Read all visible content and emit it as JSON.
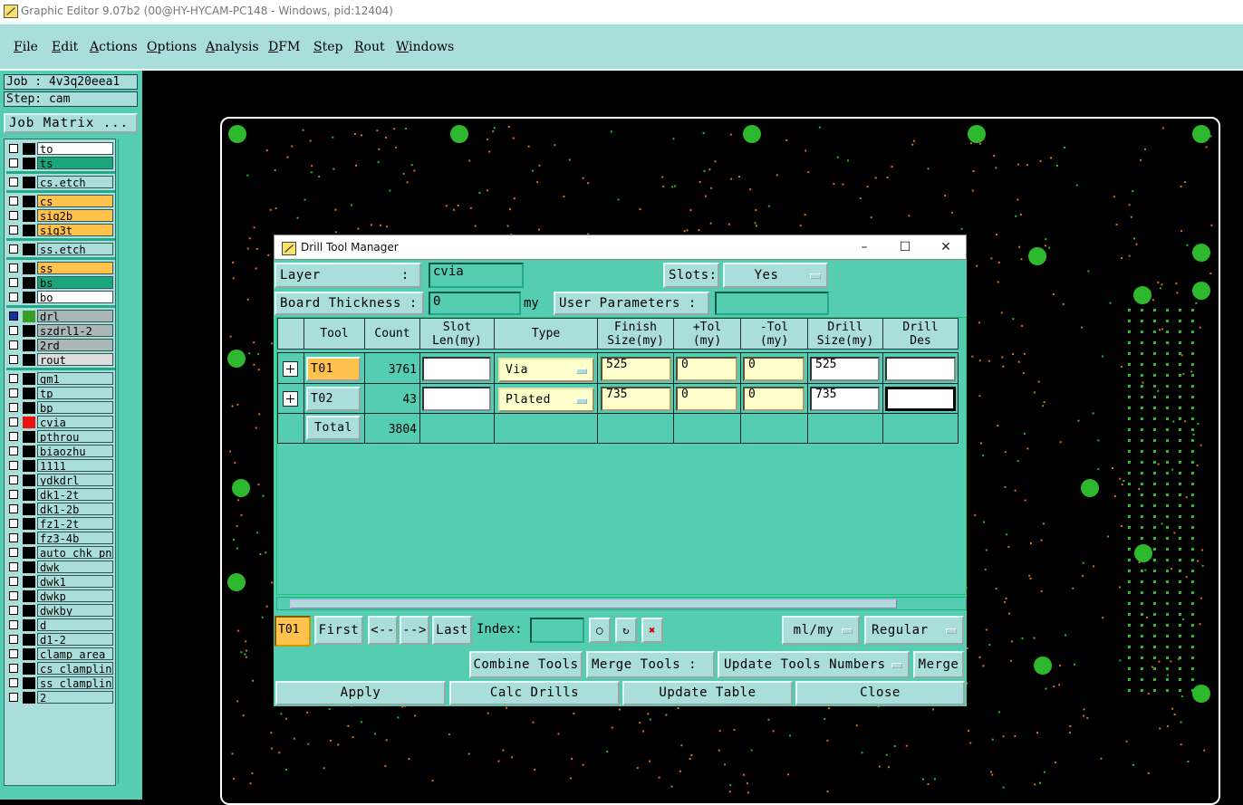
{
  "window": {
    "title": "Graphic Editor 9.07b2 (00@HY-HYCAM-PC148 - Windows, pid:12404)"
  },
  "menu": [
    "File",
    "Edit",
    "Actions",
    "Options",
    "Analysis",
    "DFM",
    "Step",
    "Rout",
    "Windows"
  ],
  "left": {
    "job": "Job : 4v3q20eea1",
    "step": "Step: cam",
    "job_matrix": "Job Matrix ..."
  },
  "layers": [
    {
      "name": "to",
      "bg": "#ffffff",
      "color": "#000000"
    },
    {
      "name": "ts",
      "bg": "#1aa57a",
      "color": "#000000"
    },
    {
      "name": "cs.etch",
      "bg": "#a9dedb",
      "color": "#000000"
    },
    {
      "name": "cs",
      "bg": "#ffc34d",
      "color": "#000000"
    },
    {
      "name": "sig2b",
      "bg": "#ffc34d",
      "color": "#000000"
    },
    {
      "name": "sig3t",
      "bg": "#ffc34d",
      "color": "#000000"
    },
    {
      "name": "ss.etch",
      "bg": "#a9dedb",
      "color": "#000000"
    },
    {
      "name": "ss",
      "bg": "#ffc34d",
      "color": "#000000"
    },
    {
      "name": "bs",
      "bg": "#1aa57a",
      "color": "#000000"
    },
    {
      "name": "bo",
      "bg": "#ffffff",
      "color": "#000000"
    },
    {
      "name": "drl",
      "bg": "#a9b7b6",
      "color": "#3a9e2b",
      "active": true
    },
    {
      "name": "szdrl1-2",
      "bg": "#a9b7b6",
      "color": "#000000"
    },
    {
      "name": "2rd",
      "bg": "#a9b7b6",
      "color": "#000000"
    },
    {
      "name": "rout",
      "bg": "#dddddd",
      "color": "#000000"
    },
    {
      "name": "gm1",
      "bg": "#a9dedb",
      "color": "#000000"
    },
    {
      "name": "tp",
      "bg": "#a9dedb",
      "color": "#000000"
    },
    {
      "name": "bp",
      "bg": "#a9dedb",
      "color": "#000000"
    },
    {
      "name": "cvia",
      "bg": "#a9dedb",
      "color": "#ee1111"
    },
    {
      "name": "pthrou",
      "bg": "#a9dedb",
      "color": "#000000"
    },
    {
      "name": "biaozhu",
      "bg": "#a9dedb",
      "color": "#000000"
    },
    {
      "name": "1111",
      "bg": "#a9dedb",
      "color": "#000000"
    },
    {
      "name": "ydkdrl",
      "bg": "#a9dedb",
      "color": "#000000"
    },
    {
      "name": "dk1-2t",
      "bg": "#a9dedb",
      "color": "#000000"
    },
    {
      "name": "dk1-2b",
      "bg": "#a9dedb",
      "color": "#000000"
    },
    {
      "name": "fz1-2t",
      "bg": "#a9dedb",
      "color": "#000000"
    },
    {
      "name": "fz3-4b",
      "bg": "#a9dedb",
      "color": "#000000"
    },
    {
      "name": "auto_chk_pnl",
      "bg": "#a9dedb",
      "color": "#000000"
    },
    {
      "name": "dwk",
      "bg": "#a9dedb",
      "color": "#000000"
    },
    {
      "name": "dwk1",
      "bg": "#a9dedb",
      "color": "#000000"
    },
    {
      "name": "dwkp",
      "bg": "#a9dedb",
      "color": "#000000"
    },
    {
      "name": "dwkby",
      "bg": "#a9dedb",
      "color": "#000000"
    },
    {
      "name": "d",
      "bg": "#a9dedb",
      "color": "#000000"
    },
    {
      "name": "d1-2",
      "bg": "#a9dedb",
      "color": "#000000"
    },
    {
      "name": "clamp_area",
      "bg": "#a9dedb",
      "color": "#000000"
    },
    {
      "name": "cs_clampline",
      "bg": "#a9dedb",
      "color": "#000000"
    },
    {
      "name": "ss_clampline",
      "bg": "#a9dedb",
      "color": "#000000"
    },
    {
      "name": "2",
      "bg": "#a9dedb",
      "color": "#000000"
    }
  ],
  "dialog": {
    "title": "Drill Tool Manager",
    "layer_label": "Layer          :",
    "layer_value": "cvia",
    "slots_label": "Slots:",
    "slots_value": "Yes",
    "board_thickness_label": "Board Thickness :",
    "board_thickness_value": "0",
    "board_thickness_unit": "my",
    "user_params_label": "User Parameters :",
    "user_params_value": "",
    "columns": [
      [
        "",
        ""
      ],
      [
        "Tool",
        ""
      ],
      [
        "Count",
        ""
      ],
      [
        "Slot",
        "Len(my)"
      ],
      [
        "Type",
        ""
      ],
      [
        "Finish",
        "Size(my)"
      ],
      [
        "+Tol",
        "(my)"
      ],
      [
        "-Tol",
        "(my)"
      ],
      [
        "Drill",
        "Size(my)"
      ],
      [
        "Drill",
        "Des"
      ]
    ],
    "rows": [
      {
        "tool": "T01",
        "count": "3761",
        "slot_len": "",
        "type": "Via",
        "finish": "525",
        "ptol": "0",
        "ntol": "0",
        "drill": "525",
        "des": ""
      },
      {
        "tool": "T02",
        "count": "43",
        "slot_len": "",
        "type": "Plated",
        "finish": "735",
        "ptol": "0",
        "ntol": "0",
        "drill": "735",
        "des": ""
      }
    ],
    "total_label": "Total",
    "total_count": "3804",
    "nav": {
      "current": "T01",
      "first": "First",
      "prev": "<--",
      "next": "-->",
      "last": "Last",
      "index_label": "Index:",
      "index_value": "",
      "units": "ml/my",
      "mode": "Regular"
    },
    "combine": "Combine Tools",
    "merge_label": "Merge Tools :",
    "merge_option": "Update Tools Numbers",
    "merge": "Merge",
    "apply": "Apply",
    "calc": "Calc Drills",
    "update": "Update Table",
    "close": "Close"
  },
  "colors": {
    "accent": "#54cdb1",
    "panel": "#a9dedb",
    "highlight": "#ffc34d",
    "pad": "#2eb82e",
    "trace": "#d9712c"
  }
}
